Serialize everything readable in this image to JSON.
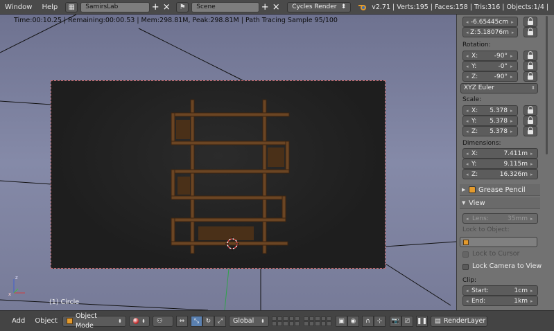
{
  "topbar": {
    "menu": [
      "Window",
      "Help"
    ],
    "screen_name": "SamirsLab",
    "scene_name": "Scene",
    "render_engine": "Cycles Render",
    "stats": "v2.71 | Verts:195 | Faces:158 | Tris:316 | Objects:1/4 |"
  },
  "viewport": {
    "status": "Time:00:10.25 | Remaining:00:00.53 | Mem:298.81M, Peak:298.81M | Path Tracing Sample 95/100",
    "object_label": "(1) Circle",
    "axis_x": "x",
    "axis_z": "z"
  },
  "properties": {
    "location_y": "-6.65445cm",
    "location_z": "5.18076m",
    "rotation_label": "Rotation:",
    "rotation": {
      "x": "-90°",
      "y": "-0°",
      "z": "-90°"
    },
    "rotation_mode": "XYZ Euler",
    "scale_label": "Scale:",
    "scale": {
      "x": "5.378",
      "y": "5.378",
      "z": "5.378"
    },
    "dimensions_label": "Dimensions:",
    "dimensions": {
      "x": "7.411m",
      "y": "9.115m",
      "z": "16.326m"
    },
    "grease_pencil": "Grease Pencil",
    "view": "View",
    "lens_label": "Lens:",
    "lens": "35mm",
    "lock_to_object": "Lock to Object:",
    "lock_to_cursor": "Lock to Cursor",
    "lock_camera": "Lock Camera to View",
    "clip_label": "Clip:",
    "clip_start_label": "Start:",
    "clip_start": "1cm",
    "clip_end_label": "End:",
    "clip_end": "1km",
    "axis_labels": {
      "x": "X:",
      "y": "Y:",
      "z": "Z:"
    }
  },
  "bottombar": {
    "menu": [
      "Add",
      "Object"
    ],
    "mode": "Object Mode",
    "orientation": "Global",
    "render_layer": "RenderLayer"
  },
  "colors": {
    "accent": "#e49b2d",
    "header": "#4a4a4a",
    "panel": "#727272",
    "viewport": "#7f84a2",
    "wood": "#6b4523"
  }
}
